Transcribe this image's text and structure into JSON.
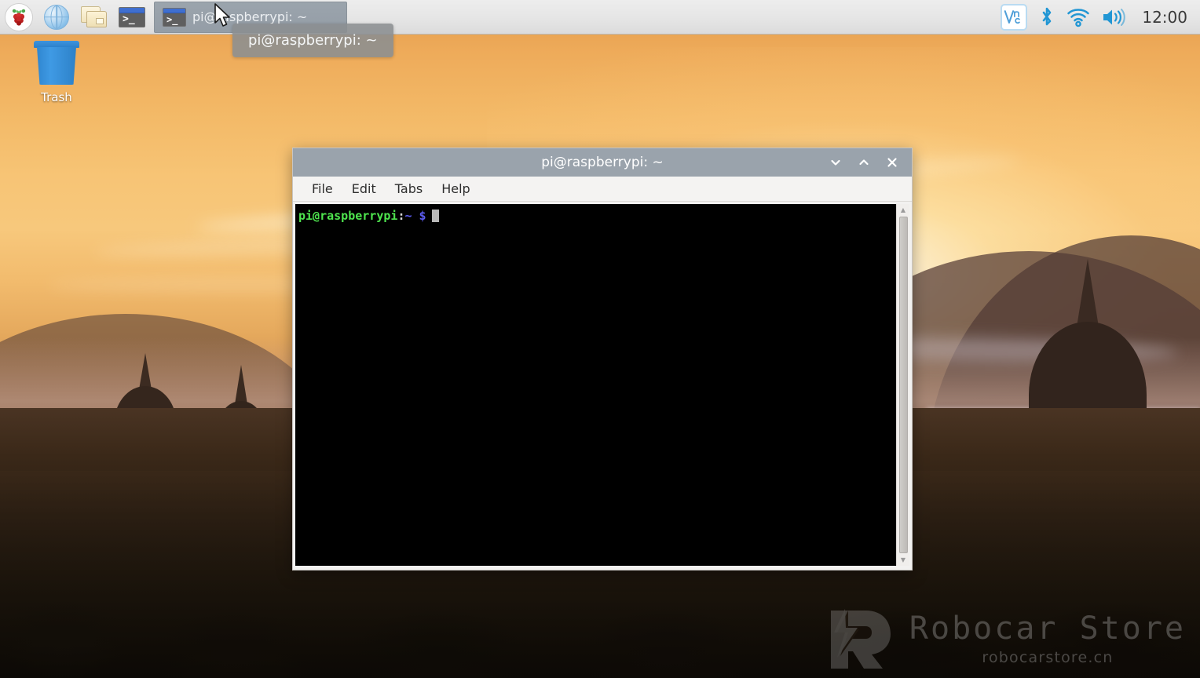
{
  "taskbar": {
    "launchers": [
      {
        "name": "raspberry-menu",
        "label": "Raspberry Pi Menu",
        "icon": "raspberry-icon"
      },
      {
        "name": "web-browser",
        "label": "Web Browser",
        "icon": "globe-icon"
      },
      {
        "name": "file-manager",
        "label": "File Manager",
        "icon": "folder-icon"
      },
      {
        "name": "terminal",
        "label": "Terminal",
        "icon": "terminal-icon"
      }
    ],
    "task_button": {
      "label": "pi@raspberrypi: ~",
      "icon": "terminal-icon"
    },
    "tooltip": "pi@raspberrypi: ~",
    "tray": {
      "vnc_label": "VNC",
      "items": [
        "vnc-icon",
        "bluetooth-icon",
        "wifi-icon",
        "volume-icon"
      ],
      "clock": "12:00"
    }
  },
  "desktop": {
    "icons": [
      {
        "name": "trash",
        "label": "Trash"
      }
    ],
    "watermark": {
      "title": "Robocar Store",
      "subtitle": "robocarstore.cn"
    }
  },
  "terminal_window": {
    "title": "pi@raspberrypi: ~",
    "controls": {
      "minimize": "˅",
      "maximize": "˄",
      "close": "✕"
    },
    "menu": [
      {
        "name": "file",
        "label": "File"
      },
      {
        "name": "edit",
        "label": "Edit"
      },
      {
        "name": "tabs",
        "label": "Tabs"
      },
      {
        "name": "help",
        "label": "Help"
      }
    ],
    "prompt": {
      "user_host": "pi@raspberrypi",
      "colon": ":",
      "path": "~",
      "sigil": "$"
    },
    "scrollbar": {
      "up": "▲",
      "down": "▼"
    }
  },
  "colors": {
    "titlebar": "#9aa3ac",
    "taskbar": "#e6e6e6",
    "accent_blue": "#2196d4",
    "prompt_green": "#4ee44e",
    "prompt_blue": "#5c5cf0",
    "terminal_bg": "#000000"
  }
}
